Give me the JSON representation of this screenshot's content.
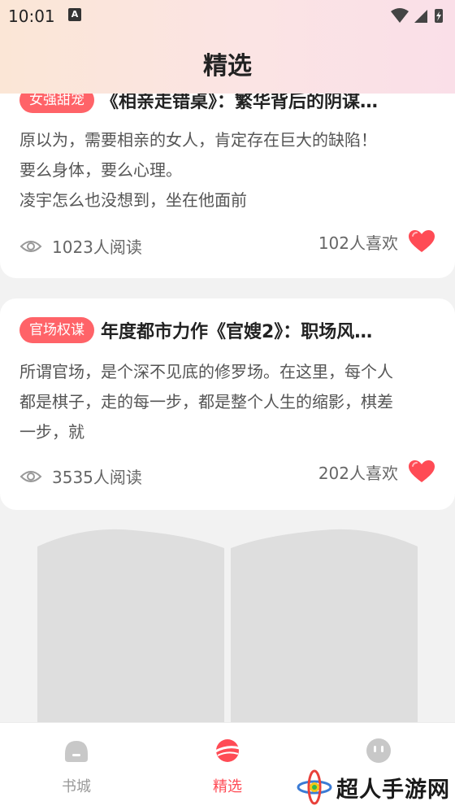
{
  "status_bar": {
    "time": "10:01",
    "app_icon": "A"
  },
  "header": {
    "title": "精选"
  },
  "articles": [
    {
      "tag": "女强甜宠",
      "title": "《相亲走错桌》：繁华背后的阴谋…",
      "excerpt": [
        "原以为，需要相亲的女人，肯定存在巨大的缺陷！",
        "要么身体，要么心理。",
        "凌宇怎么也没想到，坐在他面前"
      ],
      "reads": "1023人阅读",
      "likes": "102人喜欢"
    },
    {
      "tag": "官场权谋",
      "title": "年度都市力作《官嫂2》：职场风…",
      "excerpt": [
        "所谓官场，是个深不见底的修罗场。在这里，每个人",
        "都是棋子，走的每一步，都是整个人生的缩影，棋差",
        "一步，就"
      ],
      "reads": "3535人阅读",
      "likes": "202人喜欢"
    }
  ],
  "bottom_nav": {
    "items": [
      {
        "label": "书城",
        "icon": "bookstore-icon"
      },
      {
        "label": "精选",
        "icon": "featured-icon"
      },
      {
        "label": "",
        "icon": "profile-icon"
      }
    ],
    "active": "精选"
  },
  "watermark": {
    "text": "超人手游网"
  },
  "colors": {
    "accent": "#ff4b55",
    "tag": "#ff6368",
    "heart": "#ff4b55"
  }
}
